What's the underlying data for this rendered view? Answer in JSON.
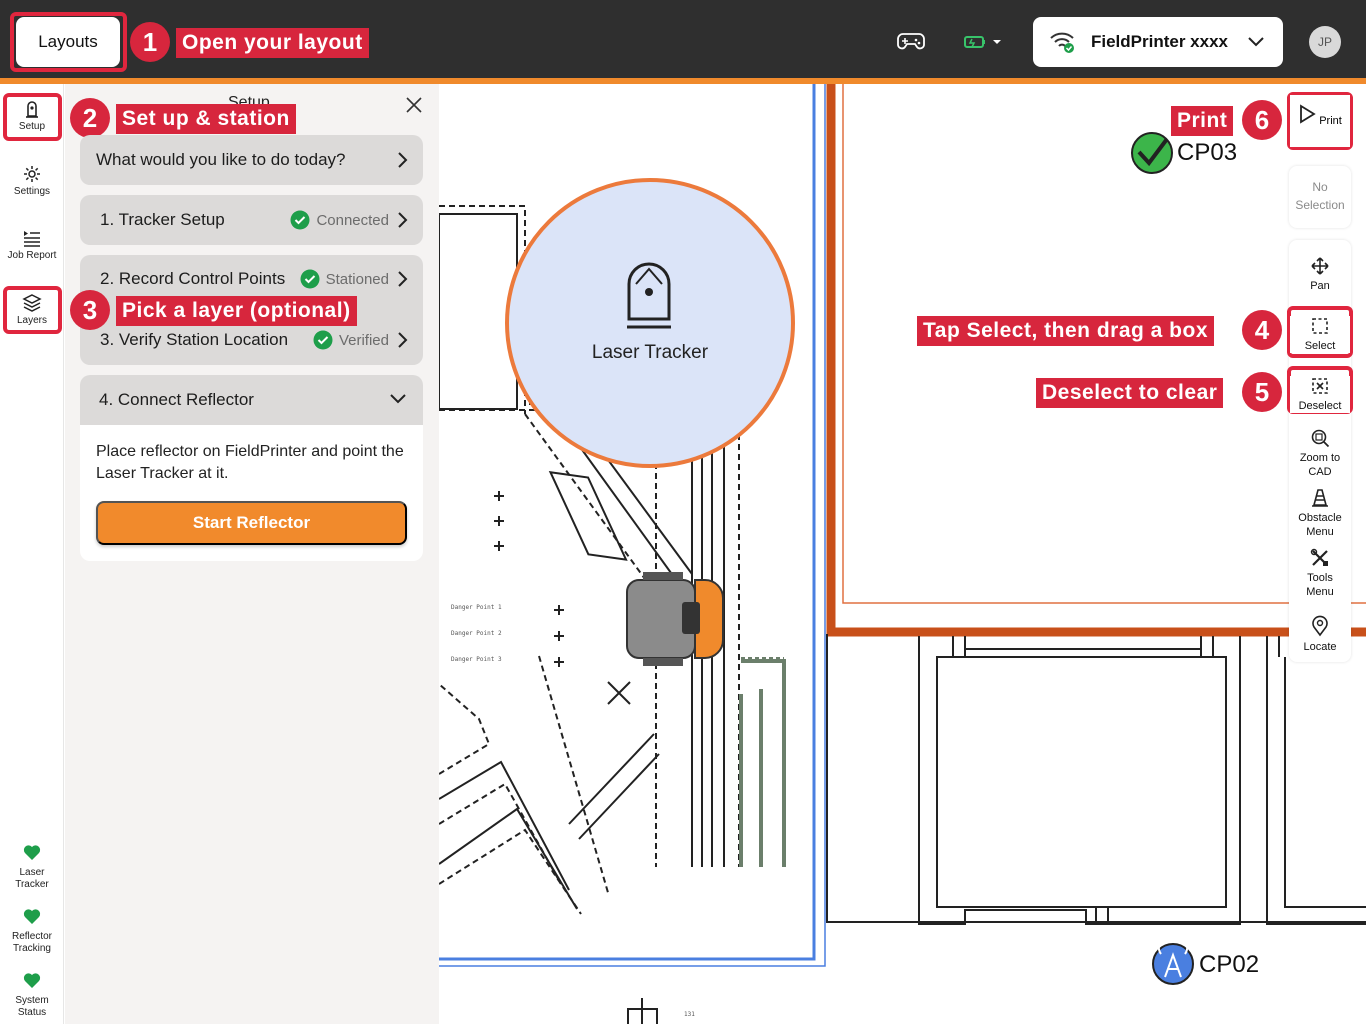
{
  "topbar": {
    "layouts_label": "Layouts",
    "printer_name": "FieldPrinter xxxx",
    "avatar_initials": "JP"
  },
  "callouts": [
    {
      "num": "1",
      "text": "Open your layout"
    },
    {
      "num": "2",
      "text": "Set up & station"
    },
    {
      "num": "3",
      "text": "Pick a layer (optional)"
    },
    {
      "num": "4",
      "text": "Tap Select, then drag a box"
    },
    {
      "num": "5",
      "text": "Deselect to clear"
    },
    {
      "num": "6",
      "text": "Print"
    }
  ],
  "leftnav": {
    "items": [
      {
        "label": "Setup"
      },
      {
        "label": "Settings"
      },
      {
        "label": "Job Report"
      },
      {
        "label": "Layers"
      }
    ],
    "status": [
      {
        "label": "Laser Tracker"
      },
      {
        "label": "Reflector Tracking"
      },
      {
        "label": "System Status"
      }
    ]
  },
  "panel": {
    "title": "Setup",
    "question": "What would you like to do today?",
    "steps": [
      {
        "label": "1. Tracker Setup",
        "status": "Connected"
      },
      {
        "label": "2. Record Control Points",
        "status": "Stationed"
      },
      {
        "label": "3. Verify Station Location",
        "status": "Verified"
      }
    ],
    "reflector": {
      "title": "4. Connect Reflector",
      "description": "Place reflector on FieldPrinter and point the Laser Tracker at it.",
      "button": "Start Reflector"
    }
  },
  "canvas": {
    "tracker_label": "Laser Tracker",
    "cp_top": "CP03",
    "cp_bottom": "CP02",
    "danger_points": [
      "Danger Point 1",
      "Danger Point 2",
      "Danger Point 3"
    ],
    "small_tag": "131"
  },
  "toolbar": {
    "print": "Print",
    "no_selection": "No Selection",
    "pan": "Pan",
    "select": "Select",
    "deselect": "Deselect",
    "zoom_to_cad": "Zoom to CAD",
    "obstacle_menu": "Obstacle Menu",
    "tools_menu": "Tools Menu",
    "locate": "Locate"
  },
  "colors": {
    "accent": "#f08a2c",
    "callout_red": "#d7263d",
    "status_green": "#1e9e4a",
    "plan_blue": "#4a7fe0",
    "plan_orange": "#c8501a"
  }
}
